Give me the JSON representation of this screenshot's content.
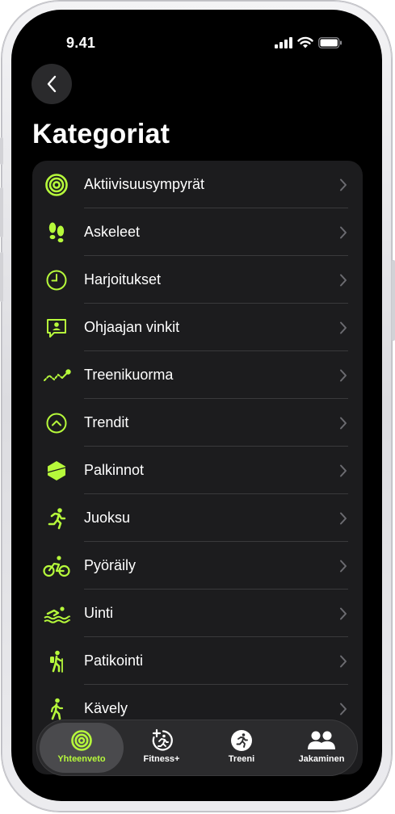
{
  "status_bar": {
    "time": "9.41"
  },
  "header": {
    "title": "Kategoriat"
  },
  "categories": [
    {
      "label": "Aktiivisuusympyrät",
      "icon": "activity-rings-icon"
    },
    {
      "label": "Askeleet",
      "icon": "footprints-icon"
    },
    {
      "label": "Harjoitukset",
      "icon": "clock-icon"
    },
    {
      "label": "Ohjaajan vinkit",
      "icon": "trainer-tips-icon"
    },
    {
      "label": "Treenikuorma",
      "icon": "training-load-icon"
    },
    {
      "label": "Trendit",
      "icon": "trends-icon"
    },
    {
      "label": "Palkinnot",
      "icon": "awards-icon"
    },
    {
      "label": "Juoksu",
      "icon": "running-icon"
    },
    {
      "label": "Pyöräily",
      "icon": "cycling-icon"
    },
    {
      "label": "Uinti",
      "icon": "swimming-icon"
    },
    {
      "label": "Patikointi",
      "icon": "hiking-icon"
    },
    {
      "label": "Kävely",
      "icon": "walking-icon"
    }
  ],
  "tab_bar": {
    "tabs": [
      {
        "label": "Yhteenveto",
        "icon": "summary-rings-icon",
        "active": true
      },
      {
        "label": "Fitness+",
        "icon": "fitness-plus-icon",
        "active": false
      },
      {
        "label": "Treeni",
        "icon": "workout-icon",
        "active": false
      },
      {
        "label": "Jakaminen",
        "icon": "sharing-icon",
        "active": false
      }
    ]
  },
  "colors": {
    "accent": "#b6f93b",
    "background": "#000000",
    "card": "#1c1c1e"
  }
}
